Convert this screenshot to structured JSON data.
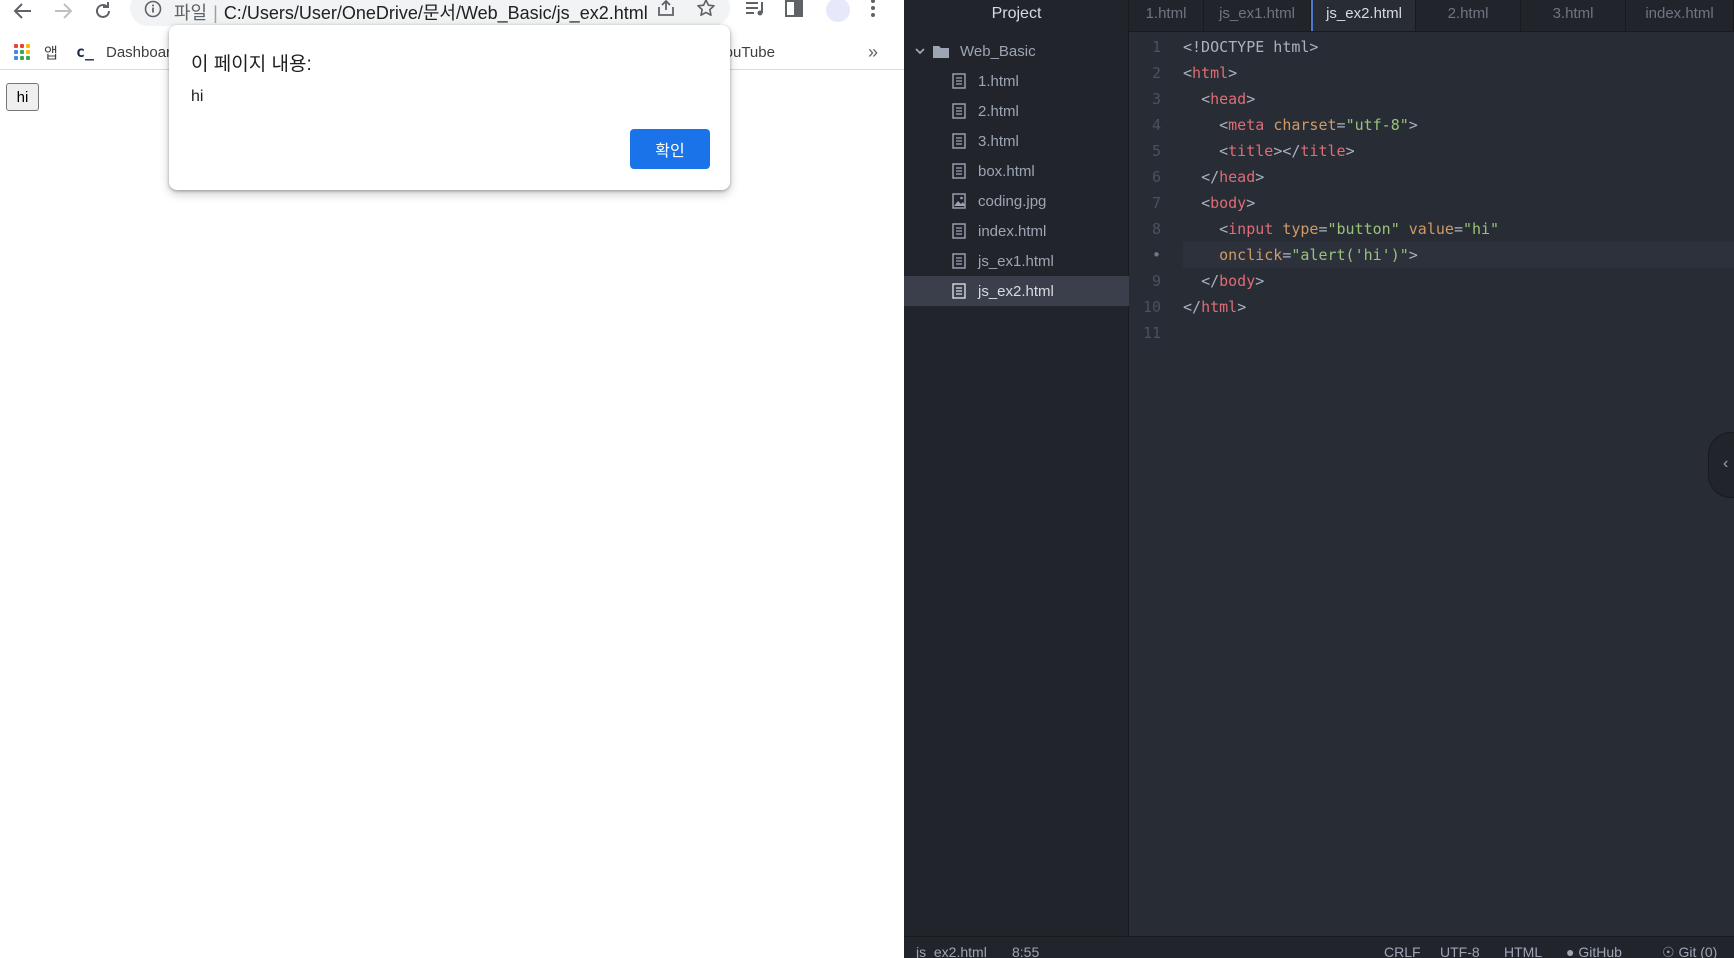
{
  "browser": {
    "address": {
      "scheme_label": "파일",
      "url": "C:/Users/User/OneDrive/문서/Web_Basic/js_ex2.html"
    },
    "bookmarks": {
      "apps_label": "앱",
      "dashboard_label": "Dashboard",
      "youtube_label": "YouTube",
      "more_label": "»"
    },
    "page": {
      "button_value": "hi"
    },
    "alert": {
      "title": "이 페이지 내용:",
      "message": "hi",
      "ok_label": "확인"
    },
    "colors": {
      "accent": "#1a73e8"
    }
  },
  "editor": {
    "tree": {
      "title": "Project",
      "folder": "Web_Basic",
      "files": [
        "1.html",
        "2.html",
        "3.html",
        "box.html",
        "coding.jpg",
        "index.html",
        "js_ex1.html",
        "js_ex2.html"
      ],
      "selected": "js_ex2.html"
    },
    "tabs": [
      "1.html",
      "js_ex1.html",
      "js_ex2.html",
      "2.html",
      "3.html",
      "index.html"
    ],
    "active_tab": "js_ex2.html",
    "line_numbers": [
      "1",
      "2",
      "3",
      "4",
      "5",
      "6",
      "7",
      "8",
      "•",
      "9",
      "10",
      "11"
    ],
    "code": {
      "l1": "<!DOCTYPE html>",
      "l2_tag": "html",
      "l3_tag": "head",
      "l4_tag": "meta",
      "l4_attr": "charset",
      "l4_val": "\"utf-8\"",
      "l5_tag": "title",
      "l6_tag": "head",
      "l7_tag": "body",
      "l8_tag": "input",
      "l8_attr1": "type",
      "l8_val1": "\"button\"",
      "l8_attr2": "value",
      "l8_val2": "\"hi\"",
      "l9_attr": "onclick",
      "l9_val": "\"alert('hi')\"",
      "l10_tag": "body",
      "l11_tag": "html"
    },
    "status": {
      "file": "js_ex2.html",
      "cursor": "8:55",
      "line_ending": "CRLF",
      "encoding": "UTF-8",
      "grammar": "HTML",
      "github": "GitHub",
      "git": "Git (0)"
    },
    "colors": {
      "background": "#282c34",
      "panel": "#21252b",
      "tag": "#e06c75",
      "attribute": "#d19a66",
      "string": "#98c379"
    }
  }
}
